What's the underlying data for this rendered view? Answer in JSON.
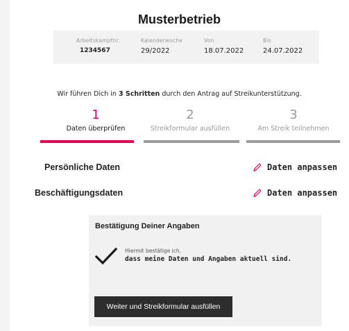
{
  "company": {
    "name": "Musterbetrieb"
  },
  "info": [
    {
      "label": "Arbeitskampfnr.",
      "value": "1234567"
    },
    {
      "label": "Kalenderwoche",
      "value": "29/2022"
    },
    {
      "label": "Von",
      "value": "18.07.2022"
    },
    {
      "label": "Bis",
      "value": "24.07.2022"
    }
  ],
  "intro": {
    "before": "Wir führen Dich in ",
    "bold": "3 Schritten",
    "after": " durch den Antrag auf Streikunterstützung."
  },
  "steps": [
    {
      "number": "1",
      "label": "Daten überprüfen",
      "state": "active"
    },
    {
      "number": "2",
      "label": "Streikformular ausfüllen",
      "state": "inactive"
    },
    {
      "number": "3",
      "label": "Am Streik teilnehmen",
      "state": "inactive"
    }
  ],
  "sections": [
    {
      "title": "Persönliche Daten",
      "edit_label": "Daten anpassen"
    },
    {
      "title": "Beschäftigungsdaten",
      "edit_label": "Daten anpassen"
    }
  ],
  "confirmation": {
    "title": "Bestätigung Deiner Angaben",
    "line1": "Hiermit bestätige ich,",
    "line2": "dass meine Daten und Angaben aktuell sind.",
    "checked": true,
    "button_label": "Weiter und Streikformular ausfüllen"
  },
  "colors": {
    "accent": "#e4004f",
    "inactive": "#9a9a9a",
    "button": "#2d2d2d"
  }
}
